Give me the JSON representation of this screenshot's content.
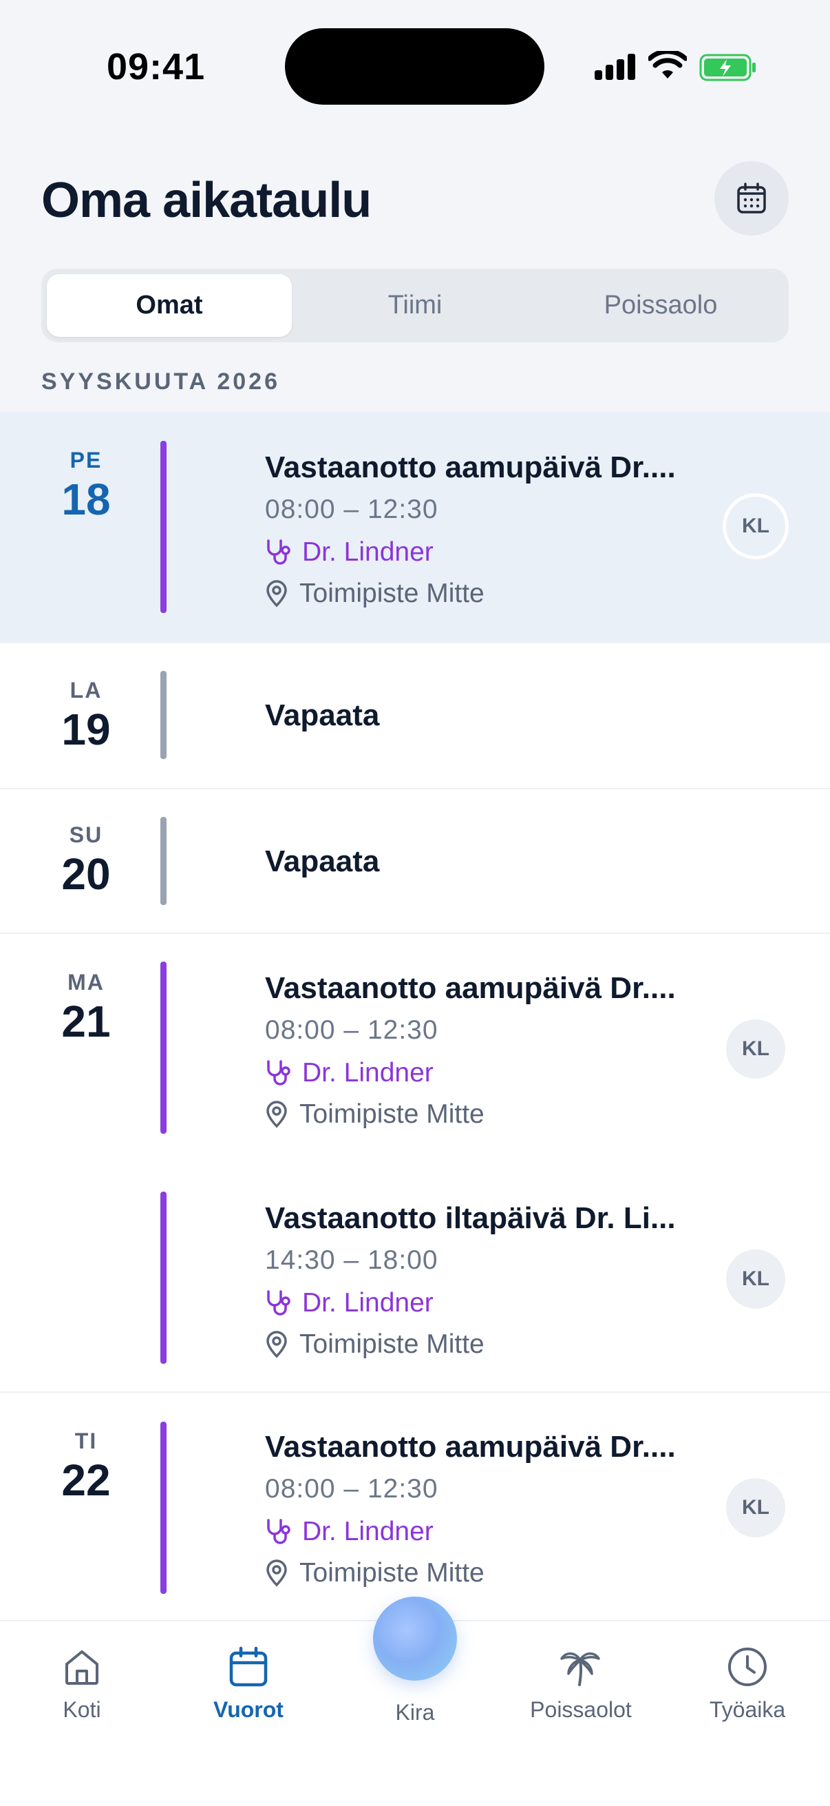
{
  "status_bar": {
    "time": "09:41"
  },
  "header": {
    "title": "Oma aikataulu"
  },
  "segments": [
    {
      "label": "Omat",
      "active": true
    },
    {
      "label": "Tiimi",
      "active": false
    },
    {
      "label": "Poissaolo",
      "active": false
    }
  ],
  "month_label": "SYYSKUUTA 2026",
  "days": [
    {
      "dow": "PE",
      "day": "18",
      "selected": true,
      "events": [
        {
          "title": "Vastaanotto aamupäivä Dr....",
          "time": "08:00 – 12:30",
          "doctor": "Dr. Lindner",
          "location": "Toimipiste Mitte",
          "avatar": "KL"
        }
      ]
    },
    {
      "dow": "LA",
      "day": "19",
      "off": "Vapaata"
    },
    {
      "dow": "SU",
      "day": "20",
      "off": "Vapaata"
    },
    {
      "dow": "MA",
      "day": "21",
      "events": [
        {
          "title": "Vastaanotto aamupäivä Dr....",
          "time": "08:00 – 12:30",
          "doctor": "Dr. Lindner",
          "location": "Toimipiste Mitte",
          "avatar": "KL"
        },
        {
          "title": "Vastaanotto iltapäivä Dr. Li...",
          "time": "14:30 – 18:00",
          "doctor": "Dr. Lindner",
          "location": "Toimipiste Mitte",
          "avatar": "KL"
        }
      ]
    },
    {
      "dow": "TI",
      "day": "22",
      "events": [
        {
          "title": "Vastaanotto aamupäivä Dr....",
          "time": "08:00 – 12:30",
          "doctor": "Dr. Lindner",
          "location": "Toimipiste Mitte",
          "avatar": "KL"
        }
      ]
    }
  ],
  "tabbar": {
    "items": [
      {
        "label": "Koti",
        "icon": "home-icon"
      },
      {
        "label": "Vuorot",
        "icon": "calendar-icon",
        "active": true
      },
      {
        "label": "Kira",
        "icon": "assistant-orb"
      },
      {
        "label": "Poissaolot",
        "icon": "palm-tree-icon"
      },
      {
        "label": "Työaika",
        "icon": "clock-icon"
      }
    ]
  },
  "colors": {
    "accent": "#1565b0",
    "purple": "#8a3ee0",
    "doctor_text": "#8b35d9",
    "battery": "#34c759"
  }
}
